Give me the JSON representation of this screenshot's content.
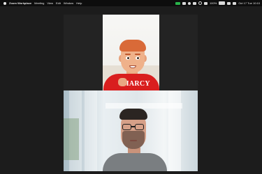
{
  "menubar": {
    "app_name": "Zoom Workplace",
    "items": [
      "Meeting",
      "View",
      "Edit",
      "Window",
      "Help"
    ],
    "status": {
      "battery_text": "100%",
      "datetime": "Oct 17 Tue 10:10"
    }
  },
  "avatar": {
    "shirt_text": "MARCY"
  },
  "colors": {
    "accent_green": "#29b34a",
    "shirt_red": "#d91e1e",
    "menubar": "#0d0d0d",
    "stage": "#1c1c1c"
  }
}
